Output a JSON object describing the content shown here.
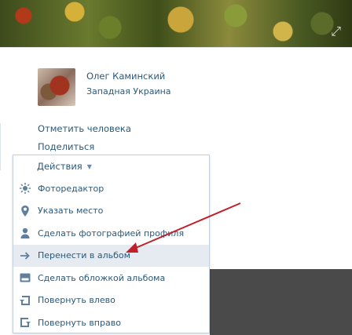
{
  "author": {
    "name": "Олег Каминский",
    "location": "Западная Украина"
  },
  "links": {
    "tag_person": "Отметить человека",
    "share": "Поделиться"
  },
  "actions_menu": {
    "title": "Действия",
    "items": [
      {
        "label": "Фоторедактор",
        "icon": "sun-icon"
      },
      {
        "label": "Указать место",
        "icon": "location-pin-icon"
      },
      {
        "label": "Сделать фотографией профиля",
        "icon": "user-icon"
      },
      {
        "label": "Перенести в альбом",
        "icon": "arrow-right-icon"
      },
      {
        "label": "Сделать обложкой альбома",
        "icon": "album-cover-icon"
      },
      {
        "label": "Повернуть влево",
        "icon": "rotate-left-icon"
      },
      {
        "label": "Повернуть вправо",
        "icon": "rotate-right-icon"
      }
    ]
  },
  "colors": {
    "link": "#2b587a",
    "icon": "#5f7f9e",
    "hover_row": "#e5ebf1",
    "annotation_arrow": "#c0202a"
  }
}
